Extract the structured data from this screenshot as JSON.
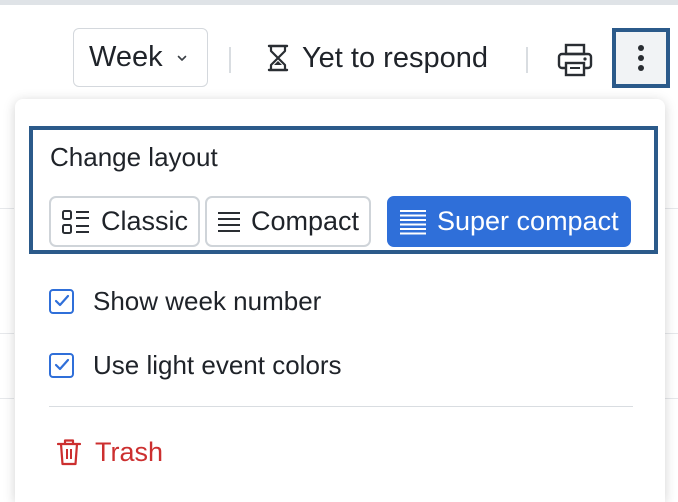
{
  "toolbar": {
    "view_select": "Week",
    "respond_filter": "Yet to respond"
  },
  "menu": {
    "layout_title": "Change layout",
    "layouts": [
      {
        "label": "Classic",
        "active": false
      },
      {
        "label": "Compact",
        "active": false
      },
      {
        "label": "Super compact",
        "active": true
      }
    ],
    "options": [
      {
        "label": "Show week number",
        "checked": true
      },
      {
        "label": "Use light event colors",
        "checked": true
      }
    ],
    "trash_label": "Trash"
  },
  "colors": {
    "accent": "#2f6fd9",
    "highlight_frame": "#2b5a8a",
    "danger": "#cc2f2f"
  }
}
